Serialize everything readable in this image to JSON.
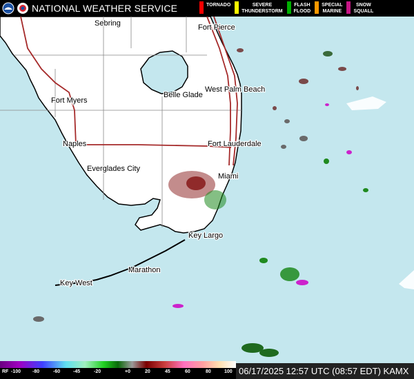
{
  "header": {
    "title": "NATIONAL WEATHER SERVICE",
    "logos": [
      "noaa-logo",
      "nws-logo"
    ]
  },
  "legend": [
    {
      "label_1": "TORNADO",
      "label_2": "",
      "color": "#ff0000"
    },
    {
      "label_1": "SEVERE",
      "label_2": "THUNDERSTORM",
      "color": "#ffff00"
    },
    {
      "label_1": "FLASH",
      "label_2": "FLOOD",
      "color": "#00b000"
    },
    {
      "label_1": "SPECIAL",
      "label_2": "MARINE",
      "color": "#ff9900"
    },
    {
      "label_1": "SNOW",
      "label_2": "SQUALL",
      "color": "#c71585"
    }
  ],
  "cities": [
    {
      "name": "Sebring"
    },
    {
      "name": "Fort Pierce"
    },
    {
      "name": "West Palm Beach"
    },
    {
      "name": "Belle Glade"
    },
    {
      "name": "Fort Myers"
    },
    {
      "name": "Naples"
    },
    {
      "name": "Fort Lauderdale"
    },
    {
      "name": "Everglades City"
    },
    {
      "name": "Miami"
    },
    {
      "name": "Key Largo"
    },
    {
      "name": "Marathon"
    },
    {
      "name": "Key West"
    }
  ],
  "colorbar": {
    "labels": [
      "RF",
      "-100",
      "-80",
      "-60",
      "-45",
      "-20",
      "+0",
      "20",
      "45",
      "60",
      "80",
      "100"
    ]
  },
  "timestamp": "06/17/2025 12:57 UTC (08:57 EDT) KAMX",
  "colors": {
    "water": "#c4e7ee",
    "land": "#ffffff",
    "county_lines": "#888888",
    "highways": "#a52a2a",
    "radar_red": "#7a0000",
    "radar_green": "#1f8a1f",
    "radar_magenta": "#cc22cc"
  }
}
